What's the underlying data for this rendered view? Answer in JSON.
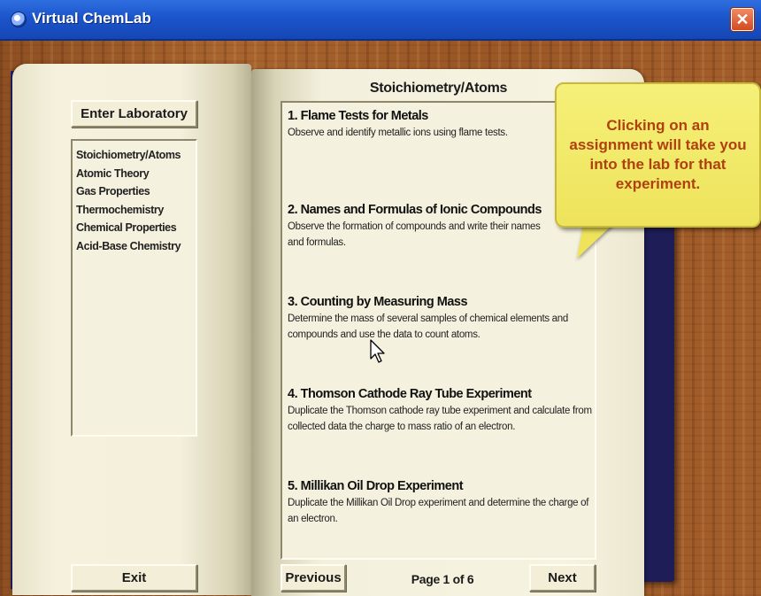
{
  "window": {
    "title": "Virtual ChemLab",
    "close_label": "✕"
  },
  "left_page": {
    "enter_button": "Enter Laboratory",
    "topics": [
      "Stoichiometry/Atoms",
      "Atomic Theory",
      "Gas Properties",
      "Thermochemistry",
      "Chemical Properties",
      "Acid-Base Chemistry"
    ],
    "exit_button": "Exit"
  },
  "right_page": {
    "heading": "Stoichiometry/Atoms",
    "assignments": [
      {
        "title": "1. Flame Tests for Metals",
        "description": "Observe and identify metallic ions using flame tests."
      },
      {
        "title": "2. Names and Formulas of Ionic Compounds",
        "description": "Observe the formation of compounds and write their names and formulas."
      },
      {
        "title": "3. Counting by Measuring Mass",
        "description": "Determine the mass of several samples of chemical elements and compounds and use the data to count atoms."
      },
      {
        "title": "4. Thomson Cathode Ray Tube Experiment",
        "description": "Duplicate the Thomson cathode ray tube experiment and calculate from collected data the charge to mass ratio of an electron."
      },
      {
        "title": "5. Millikan Oil Drop Experiment",
        "description": "Duplicate the Millikan Oil Drop experiment and determine the charge of an electron."
      }
    ],
    "previous_button": "Previous",
    "page_indicator": "Page 1 of 6",
    "next_button": "Next"
  },
  "callout": {
    "text": "Clicking on an assignment will take you into the lab for that experiment."
  },
  "colors": {
    "titlebar": "#1b55cc",
    "callout_bg": "#eee35b",
    "callout_text": "#b04010",
    "book_cover": "#1f1d58"
  }
}
